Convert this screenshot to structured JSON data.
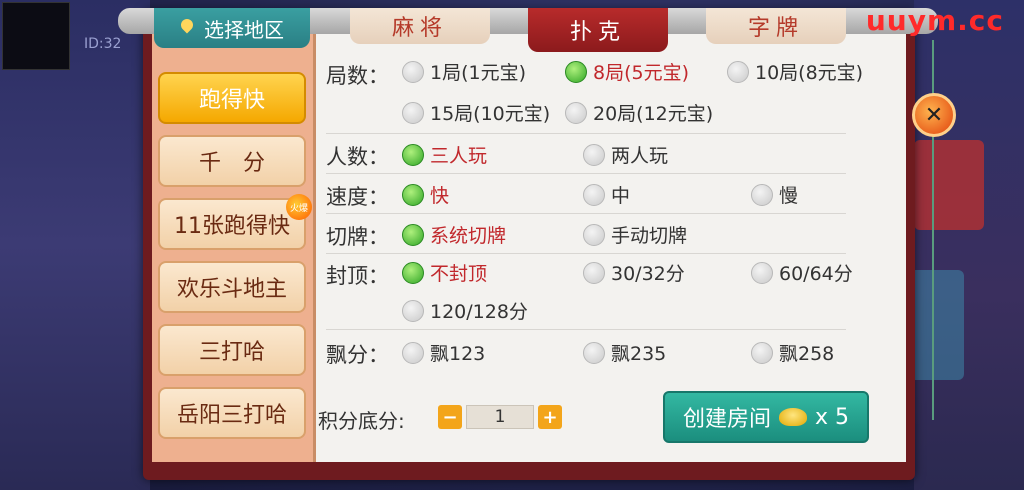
{
  "watermark": "uuym.cc",
  "background": {
    "id_text": "ID:32"
  },
  "header": {
    "region_tab": "选择地区",
    "game_tabs": [
      {
        "label": "麻将",
        "active": false
      },
      {
        "label": "扑克",
        "active": true
      },
      {
        "label": "字牌",
        "active": false
      }
    ]
  },
  "sidebar": {
    "items": [
      {
        "label": "跑得快",
        "active": true
      },
      {
        "label": "千　分",
        "active": false
      },
      {
        "label": "11张跑得快",
        "active": false,
        "badge": "火爆"
      },
      {
        "label": "欢乐斗地主",
        "active": false
      },
      {
        "label": "三打哈",
        "active": false
      },
      {
        "label": "岳阳三打哈",
        "active": false
      }
    ]
  },
  "settings": {
    "rounds": {
      "label": "局数：",
      "options": [
        "1局(1元宝)",
        "8局(5元宝)",
        "10局(8元宝)",
        "15局(10元宝)",
        "20局(12元宝)"
      ],
      "selected": "8局(5元宝)"
    },
    "players": {
      "label": "人数：",
      "options": [
        "三人玩",
        "两人玩"
      ],
      "selected": "三人玩"
    },
    "speed": {
      "label": "速度：",
      "options": [
        "快",
        "中",
        "慢"
      ],
      "selected": "快"
    },
    "cut": {
      "label": "切牌：",
      "options": [
        "系统切牌",
        "手动切牌"
      ],
      "selected": "系统切牌"
    },
    "cap": {
      "label": "封顶：",
      "options": [
        "不封顶",
        "30/32分",
        "60/64分",
        "120/128分"
      ],
      "selected": "不封顶"
    },
    "piao": {
      "label": "飘分：",
      "options": [
        "飘123",
        "飘235",
        "飘258"
      ],
      "selected": ""
    },
    "base_score": {
      "label": "积分底分:",
      "value": "1",
      "minus": "−",
      "plus": "+"
    }
  },
  "create_button": {
    "label": "创建房间",
    "cost": "x 5"
  },
  "close_label": "✕",
  "colors": {
    "accent_green": "#31a626",
    "selected_text": "#c1282c",
    "create_teal": "#1b8e7e"
  }
}
